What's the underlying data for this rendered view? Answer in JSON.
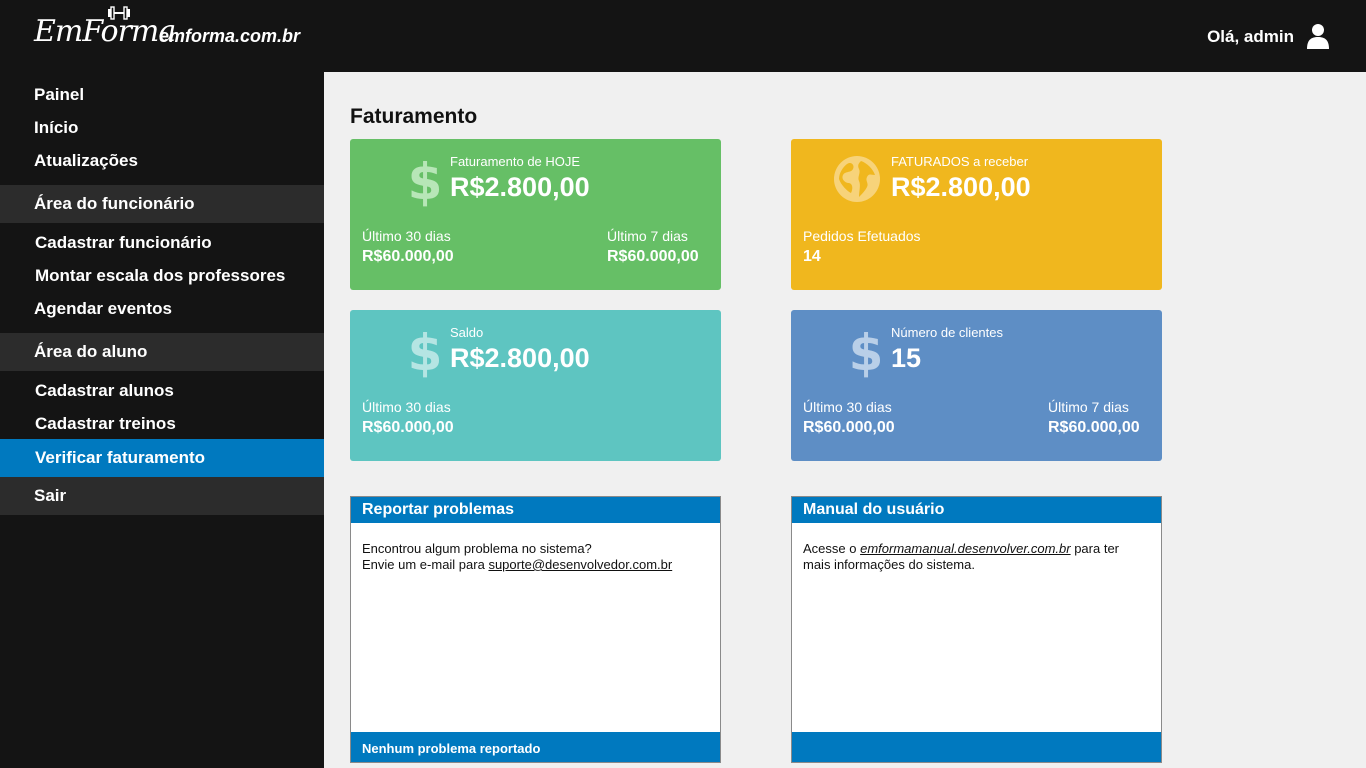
{
  "header": {
    "logo": "EmForma",
    "site": "emforma.com.br",
    "greeting": "Olá, admin"
  },
  "sidebar": {
    "items_top": [
      "Painel",
      "Início",
      "Atualizações"
    ],
    "section_employee": "Área do funcionário",
    "employee_items": [
      "Cadastrar funcionário",
      "Montar escala dos professores",
      "Agendar eventos"
    ],
    "section_student": "Área do aluno",
    "student_items": [
      "Cadastrar alunos",
      "Cadastrar treinos",
      "Verificar faturamento"
    ],
    "exit": "Sair"
  },
  "main": {
    "title": "Faturamento",
    "cards": {
      "today": {
        "label": "Faturamento de HOJE",
        "value": "R$2.800,00",
        "left_label": "Último 30 dias",
        "left_value": "R$60.000,00",
        "right_label": "Último 7 dias",
        "right_value": "R$60.000,00",
        "color": "#66bf66"
      },
      "receivable": {
        "label": "FATURADOS a receber",
        "value": "R$2.800,00",
        "left_label": "Pedidos Efetuados",
        "left_value": "14",
        "color": "#f0b71e"
      },
      "balance": {
        "label": "Saldo",
        "value": "R$2.800,00",
        "left_label": "Último 30 dias",
        "left_value": "R$60.000,00",
        "color": "#5ec5c1"
      },
      "clients": {
        "label": "Número de clientes",
        "value": "15",
        "left_label": "Último 30 dias",
        "left_value": "R$60.000,00",
        "right_label": "Último 7 dias",
        "right_value": "R$60.000,00",
        "color": "#5e8ec5"
      }
    },
    "panels": {
      "report": {
        "title": "Reportar problemas",
        "line1": "Encontrou algum problema no sistema?",
        "line2_prefix": "Envie um e-mail para ",
        "email": "suporte@desenvolvedor.com.br",
        "footer": "Nenhum problema reportado"
      },
      "manual": {
        "title": "Manual do usuário",
        "prefix": "Acesse o ",
        "link": "emformamanual.desenvolver.com.br",
        "suffix": " para ter mais informações do sistema.",
        "footer": ""
      }
    }
  },
  "colors": {
    "accent": "#0079bf",
    "sidebar_bg": "#141414",
    "section_bg": "#2c2c2c"
  },
  "icons": [
    "dollar-icon",
    "globe-icon",
    "user-icon",
    "dumbbell-icon"
  ]
}
